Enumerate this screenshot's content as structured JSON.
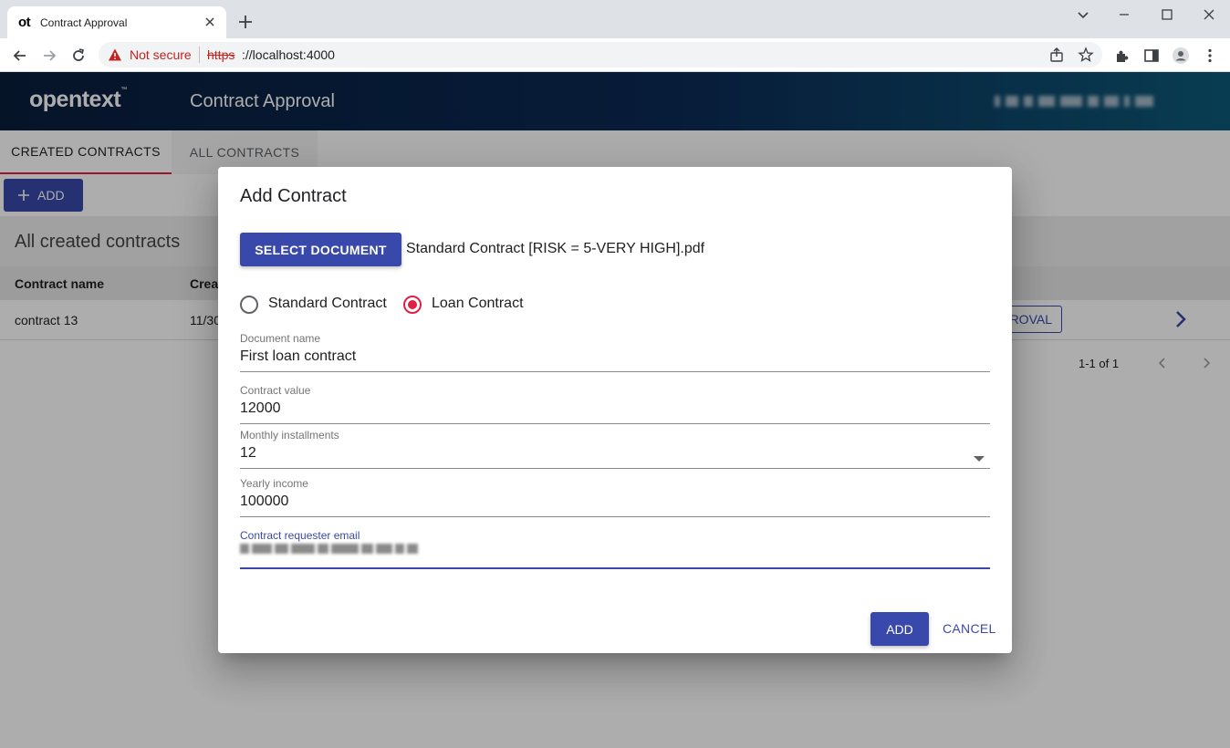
{
  "browser": {
    "tab_favicon": "ot",
    "tab_title": "Contract Approval",
    "security_label": "Not secure",
    "url_scheme": "https",
    "url_rest": "://localhost:4000",
    "icons": [
      "back-icon",
      "forward-icon",
      "reload-icon",
      "warning-icon",
      "share-icon",
      "star-icon",
      "extensions-icon",
      "side-panel-icon",
      "profile-icon",
      "menu-icon"
    ]
  },
  "app": {
    "logo": "opentext",
    "logo_tm": "™",
    "title": "Contract Approval",
    "header_gradient": [
      "#0a1e3c",
      "#0b2a55",
      "#0d5a78"
    ]
  },
  "page": {
    "tabs": [
      {
        "label": "CREATED CONTRACTS",
        "active": true
      },
      {
        "label": "ALL CONTRACTS",
        "active": false
      }
    ],
    "add_button": "ADD",
    "section_title": "All created contracts",
    "columns": [
      "Contract name",
      "Crea"
    ],
    "rows": [
      {
        "name": "contract 13",
        "created": "11/30",
        "action": "ROVAL"
      }
    ],
    "pagination": "1-1 of 1"
  },
  "dialog": {
    "title": "Add Contract",
    "select_document": "SELECT DOCUMENT",
    "file_name": "Standard Contract [RISK = 5-VERY HIGH].pdf",
    "contract_types": [
      {
        "label": "Standard Contract",
        "selected": false
      },
      {
        "label": "Loan Contract",
        "selected": true
      }
    ],
    "fields": {
      "document_name": {
        "label": "Document name",
        "value": "First loan contract"
      },
      "contract_value": {
        "label": "Contract value",
        "value": "12000"
      },
      "monthly_installments": {
        "label": "Monthly installments",
        "value": "12"
      },
      "yearly_income": {
        "label": "Yearly income",
        "value": "100000"
      },
      "requester_email": {
        "label": "Contract requester email"
      }
    },
    "add_label": "ADD",
    "cancel_label": "CANCEL"
  },
  "colors": {
    "primary": "#3949ab",
    "accent": "#e02040",
    "warning": "#c5221f"
  }
}
